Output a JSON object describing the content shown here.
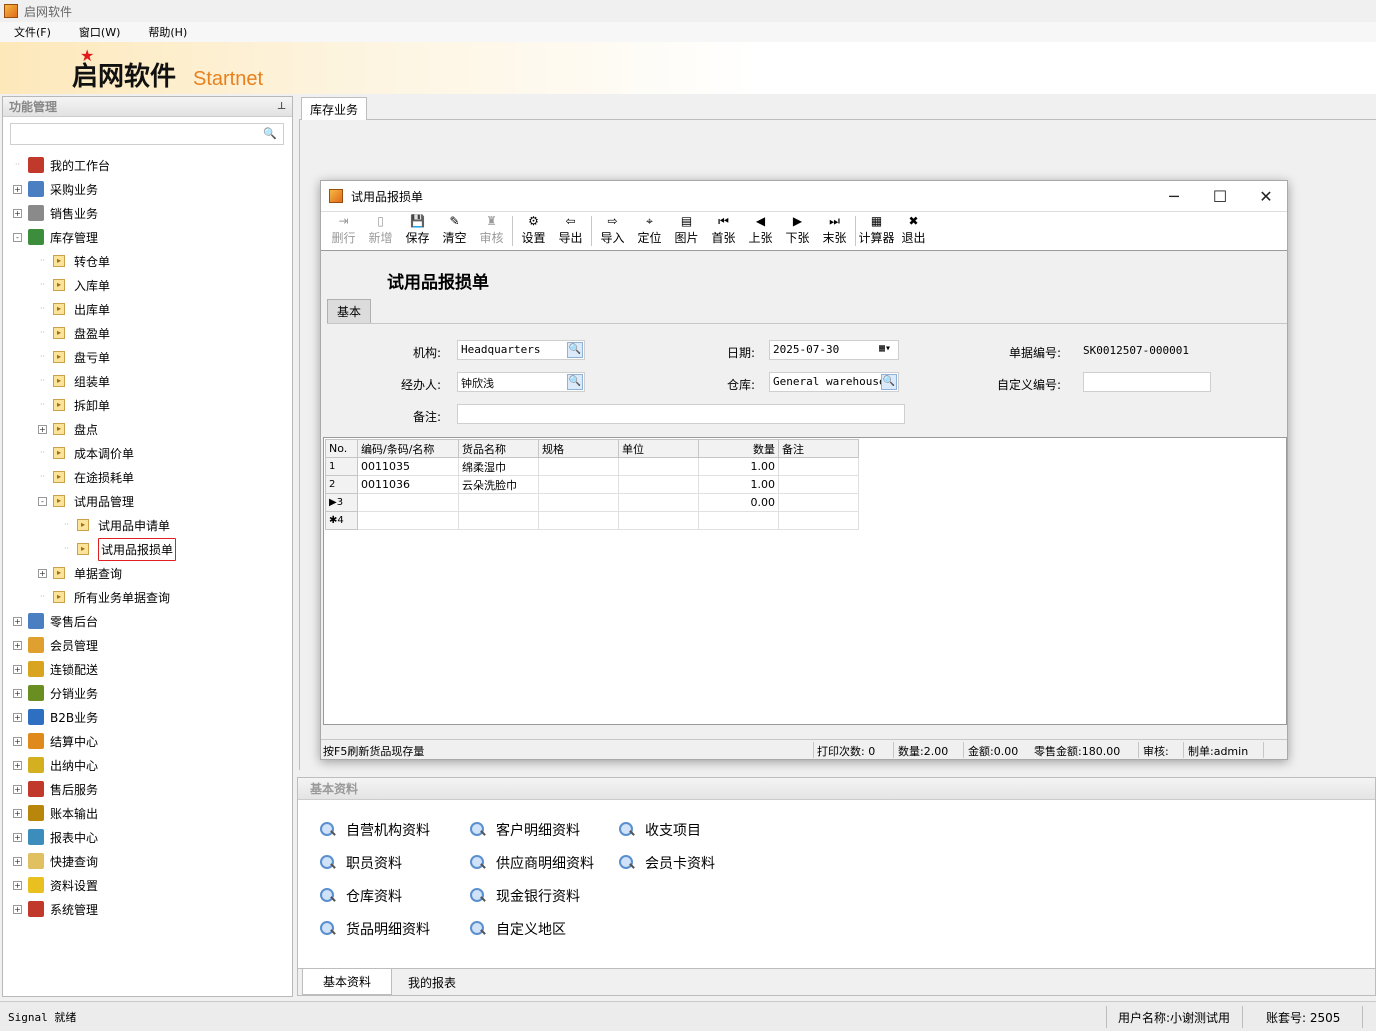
{
  "app": {
    "title": "启网软件"
  },
  "menu": [
    "文件(F)",
    "窗口(W)",
    "帮助(H)"
  ],
  "banner": {
    "logo_cn": "启网软件",
    "logo_en": "Startnet"
  },
  "left_panel": {
    "header": "功能管理",
    "pin": "ᴾ",
    "search_placeholder": "",
    "tree": [
      {
        "label": "我的工作台",
        "level": 0,
        "expander": "",
        "icon": "desk-icon",
        "color": "#c0392b"
      },
      {
        "label": "采购业务",
        "level": 0,
        "expander": "+",
        "icon": "purchase-icon",
        "color": "#4a7fc1"
      },
      {
        "label": "销售业务",
        "level": 0,
        "expander": "+",
        "icon": "sales-icon",
        "color": "#8a8a8a"
      },
      {
        "label": "库存管理",
        "level": 0,
        "expander": "-",
        "icon": "inventory-icon",
        "color": "#3c8d3c"
      },
      {
        "label": "转仓单",
        "level": 1,
        "expander": ""
      },
      {
        "label": "入库单",
        "level": 1,
        "expander": ""
      },
      {
        "label": "出库单",
        "level": 1,
        "expander": ""
      },
      {
        "label": "盘盈单",
        "level": 1,
        "expander": ""
      },
      {
        "label": "盘亏单",
        "level": 1,
        "expander": ""
      },
      {
        "label": "组装单",
        "level": 1,
        "expander": ""
      },
      {
        "label": "拆卸单",
        "level": 1,
        "expander": ""
      },
      {
        "label": "盘点",
        "level": 1,
        "expander": "+"
      },
      {
        "label": "成本调价单",
        "level": 1,
        "expander": ""
      },
      {
        "label": "在途损耗单",
        "level": 1,
        "expander": ""
      },
      {
        "label": "试用品管理",
        "level": 1,
        "expander": "-"
      },
      {
        "label": "试用品申请单",
        "level": 2,
        "expander": ""
      },
      {
        "label": "试用品报损单",
        "level": 2,
        "expander": "",
        "selected": true
      },
      {
        "label": "单据查询",
        "level": 1,
        "expander": "+"
      },
      {
        "label": "所有业务单据查询",
        "level": 1,
        "expander": ""
      },
      {
        "label": "零售后台",
        "level": 0,
        "expander": "+",
        "icon": "cart-icon",
        "color": "#4a7fc1"
      },
      {
        "label": "会员管理",
        "level": 0,
        "expander": "+",
        "icon": "member-icon",
        "color": "#e0a030"
      },
      {
        "label": "连锁配送",
        "level": 0,
        "expander": "+",
        "icon": "truck-icon",
        "color": "#d9a520"
      },
      {
        "label": "分销业务",
        "level": 0,
        "expander": "+",
        "icon": "distribution-icon",
        "color": "#6b8e23"
      },
      {
        "label": "B2B业务",
        "level": 0,
        "expander": "+",
        "icon": "b2b-icon",
        "color": "#2e6fc2"
      },
      {
        "label": "结算中心",
        "level": 0,
        "expander": "+",
        "icon": "settlement-icon",
        "color": "#e08a1e"
      },
      {
        "label": "出纳中心",
        "level": 0,
        "expander": "+",
        "icon": "yen-icon",
        "color": "#d4b020"
      },
      {
        "label": "售后服务",
        "level": 0,
        "expander": "+",
        "icon": "service-icon",
        "color": "#c0392b"
      },
      {
        "label": "账本输出",
        "level": 0,
        "expander": "+",
        "icon": "ledger-icon",
        "color": "#b8860b"
      },
      {
        "label": "报表中心",
        "level": 0,
        "expander": "+",
        "icon": "report-icon",
        "color": "#3c8dbc"
      },
      {
        "label": "快捷查询",
        "level": 0,
        "expander": "+",
        "icon": "quick-query-icon",
        "color": "#e0c060"
      },
      {
        "label": "资料设置",
        "level": 0,
        "expander": "+",
        "icon": "folder-settings-icon",
        "color": "#e8c020"
      },
      {
        "label": "系统管理",
        "level": 0,
        "expander": "+",
        "icon": "system-icon",
        "color": "#c0392b"
      }
    ]
  },
  "tabs": {
    "main": "库存业务"
  },
  "dialog": {
    "title": "试用品报损单",
    "heading": "试用品报损单",
    "toolbar": [
      {
        "label": "删行",
        "icon": "delete-row-icon",
        "glyph": "⇥",
        "enabled": false
      },
      {
        "label": "新增",
        "icon": "new-doc-icon",
        "glyph": "▯",
        "enabled": false
      },
      {
        "label": "保存",
        "icon": "save-icon",
        "glyph": "💾",
        "enabled": true
      },
      {
        "label": "清空",
        "icon": "broom-icon",
        "glyph": "✎",
        "enabled": true
      },
      {
        "label": "审核",
        "icon": "stamp-icon",
        "glyph": "♜",
        "enabled": false
      },
      {
        "label": "设置",
        "icon": "settings-icon",
        "glyph": "⚙",
        "enabled": true
      },
      {
        "label": "导出",
        "icon": "export-icon",
        "glyph": "⇦",
        "enabled": true
      },
      {
        "label": "导入",
        "icon": "import-icon",
        "glyph": "⇨",
        "enabled": true
      },
      {
        "label": "定位",
        "icon": "binoculars-icon",
        "glyph": "⌖",
        "enabled": true
      },
      {
        "label": "图片",
        "icon": "image-icon",
        "glyph": "▤",
        "enabled": true
      },
      {
        "label": "首张",
        "icon": "first-icon",
        "glyph": "⏮",
        "enabled": true
      },
      {
        "label": "上张",
        "icon": "prev-icon",
        "glyph": "◀",
        "enabled": true
      },
      {
        "label": "下张",
        "icon": "next-icon",
        "glyph": "▶",
        "enabled": true
      },
      {
        "label": "末张",
        "icon": "last-icon",
        "glyph": "⏭",
        "enabled": true
      },
      {
        "label": "计算器",
        "icon": "calculator-icon",
        "glyph": "▦",
        "enabled": true
      },
      {
        "label": "退出",
        "icon": "exit-icon",
        "glyph": "✖",
        "enabled": true
      }
    ],
    "subtab": "基本",
    "form": {
      "org_label": "机构:",
      "org_value": "Headquarters",
      "date_label": "日期:",
      "date_value": "2025-07-30",
      "docno_label": "单据编号:",
      "docno_value": "SK0012507-000001",
      "handler_label": "经办人:",
      "handler_value": "钟欣浅",
      "warehouse_label": "仓库:",
      "warehouse_value": "General warehouse",
      "custom_no_label": "自定义编号:",
      "custom_no_value": "",
      "remark_label": "备注:",
      "remark_value": ""
    },
    "grid": {
      "columns": [
        "No.",
        "编码/条码/名称",
        "货品名称",
        "规格",
        "单位",
        "数量",
        "备注"
      ],
      "rows": [
        {
          "no": "1",
          "code": "0011035",
          "name": "绵柔湿巾",
          "spec": "",
          "unit": "",
          "qty": "1.00",
          "remark": ""
        },
        {
          "no": "2",
          "code": "0011036",
          "name": "云朵洗脸巾",
          "spec": "",
          "unit": "",
          "qty": "1.00",
          "remark": ""
        },
        {
          "no": "▶3",
          "code": "",
          "name": "",
          "spec": "",
          "unit": "",
          "qty": "0.00",
          "remark": ""
        },
        {
          "no": "✱4",
          "code": "",
          "name": "",
          "spec": "",
          "unit": "",
          "qty": "",
          "remark": ""
        }
      ]
    },
    "status": {
      "hint": "按F5刷新货品现存量",
      "print_count": "打印次数: 0",
      "quantity": "数量:2.00",
      "amount": "金额:0.00",
      "retail_amount": "零售金额:180.00",
      "auditor": "审核:",
      "maker": "制单:admin"
    }
  },
  "base_panel": {
    "header": "基本资料",
    "links": [
      [
        "自营机构资料",
        "职员资料",
        "仓库资料",
        "货品明细资料"
      ],
      [
        "客户明细资料",
        "供应商明细资料",
        "现金银行资料",
        "自定义地区"
      ],
      [
        "收支项目",
        "会员卡资料"
      ]
    ],
    "tabs": [
      "基本资料",
      "我的报表"
    ]
  },
  "statusbar": {
    "left": "Signal 就绪",
    "user": "用户名称:小谢测试用",
    "account": "账套号: 2505"
  }
}
